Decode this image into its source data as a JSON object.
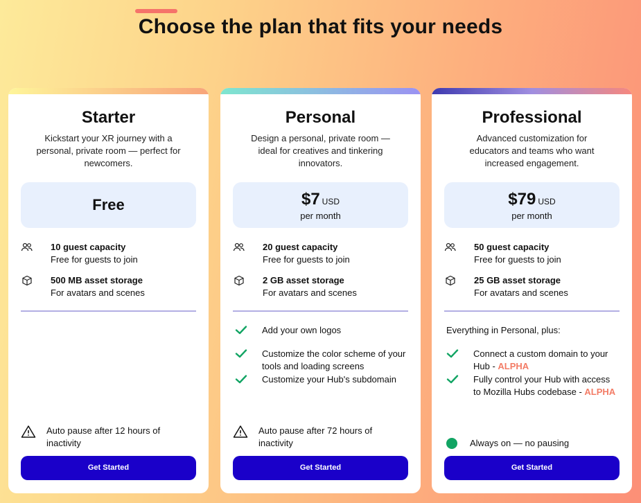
{
  "headline": "Choose the plan that fits your needs",
  "colors": {
    "cta": "#1a00c9",
    "alpha": "#f37c66",
    "check": "#11a463",
    "divider": "#b2aee3",
    "price_box": "#e8f0fd"
  },
  "plans": [
    {
      "name": "Starter",
      "description": "Kickstart your XR journey with a personal, private room — perfect for newcomers.",
      "price_label": "Free",
      "features": [
        {
          "icon": "users-icon",
          "title": "10 guest capacity",
          "subtitle": "Free for guests to join"
        },
        {
          "icon": "cube-icon",
          "title": "500 MB asset storage",
          "subtitle": "For avatars and scenes"
        }
      ],
      "note": "Auto pause after 12 hours of inactivity",
      "cta": "Get Started"
    },
    {
      "name": "Personal",
      "description": "Design a personal, private room — ideal for creatives and tinkering innovators.",
      "price": "$7",
      "currency": "USD",
      "period": "per month",
      "features": [
        {
          "icon": "users-icon",
          "title": "20 guest capacity",
          "subtitle": "Free for guests to join"
        },
        {
          "icon": "cube-icon",
          "title": "2 GB asset storage",
          "subtitle": "For avatars and scenes"
        }
      ],
      "extras": [
        "Add your own logos",
        "Customize the color scheme of your tools and loading screens",
        "Customize your Hub's subdomain"
      ],
      "note": "Auto pause after 72 hours of inactivity",
      "cta": "Get Started"
    },
    {
      "name": "Professional",
      "description": "Advanced customization for educators and teams who want increased engagement.",
      "price": "$79",
      "currency": "USD",
      "period": "per month",
      "features": [
        {
          "icon": "users-icon",
          "title": "50 guest capacity",
          "subtitle": "Free for guests to join"
        },
        {
          "icon": "cube-icon",
          "title": "25 GB asset storage",
          "subtitle": "For avatars and scenes"
        }
      ],
      "extras_intro": "Everything in Personal, plus:",
      "extras": [
        {
          "text": "Connect a custom domain to your Hub - ",
          "badge": "ALPHA"
        },
        {
          "text": "Fully control your Hub with access to Mozilla Hubs codebase - ",
          "badge": "ALPHA"
        }
      ],
      "always_on": "Always on — no pausing",
      "cta": "Get Started"
    }
  ]
}
